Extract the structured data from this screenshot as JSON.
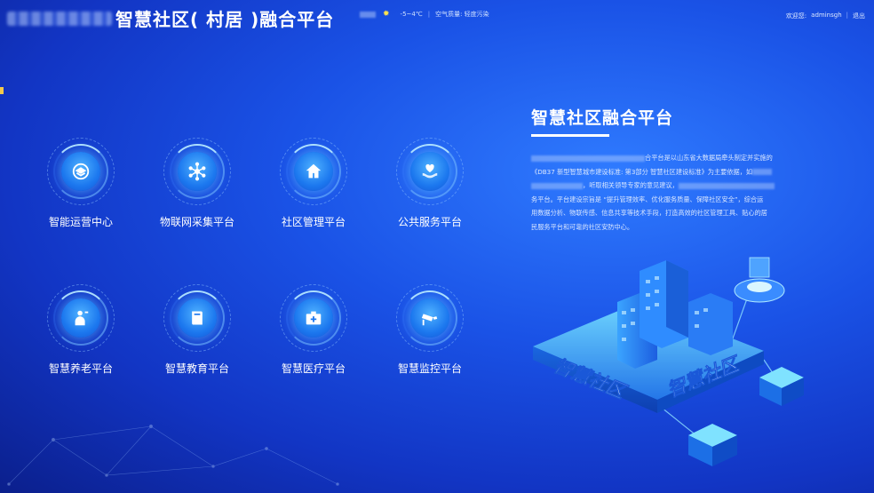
{
  "header": {
    "title": "智慧社区( 村居 )融合平台",
    "weather_temp": "-5~4℃",
    "air_quality": "空气质量: 轻度污染",
    "welcome": "欢迎您:",
    "username": "adminsgh",
    "logout": "退出"
  },
  "modules": [
    {
      "label": "智能运营中心",
      "icon": "layers-icon"
    },
    {
      "label": "物联网采集平台",
      "icon": "network-node-icon"
    },
    {
      "label": "社区管理平台",
      "icon": "home-icon"
    },
    {
      "label": "公共服务平台",
      "icon": "hand-heart-icon"
    },
    {
      "label": "智慧养老平台",
      "icon": "elder-icon"
    },
    {
      "label": "智慧教育平台",
      "icon": "book-icon"
    },
    {
      "label": "智慧医疗平台",
      "icon": "medical-kit-icon"
    },
    {
      "label": "智慧监控平台",
      "icon": "camera-icon"
    }
  ],
  "intro": {
    "title": "智慧社区融合平台",
    "p1": "合平台是以山东省大数据局牵头制定并实施的",
    "p2": "《DB37 新型智慧城市建设标准: 第3部分 智慧社区建设标准》为主要依据，如",
    "p3": "，听取相关领导专家的意见建议，",
    "p4": "务平台。平台建设宗旨是 “提升管理效率、优化服务质量、保障社区安全”，综合运",
    "p5": "用数据分析、物联传感、信息共享等技术手段，打造高效的社区管理工具、贴心的居",
    "p6": "民服务平台和可靠的社区安防中心。"
  },
  "illustration": {
    "text_left": "智慧社区",
    "text_right": "智慧社区"
  }
}
